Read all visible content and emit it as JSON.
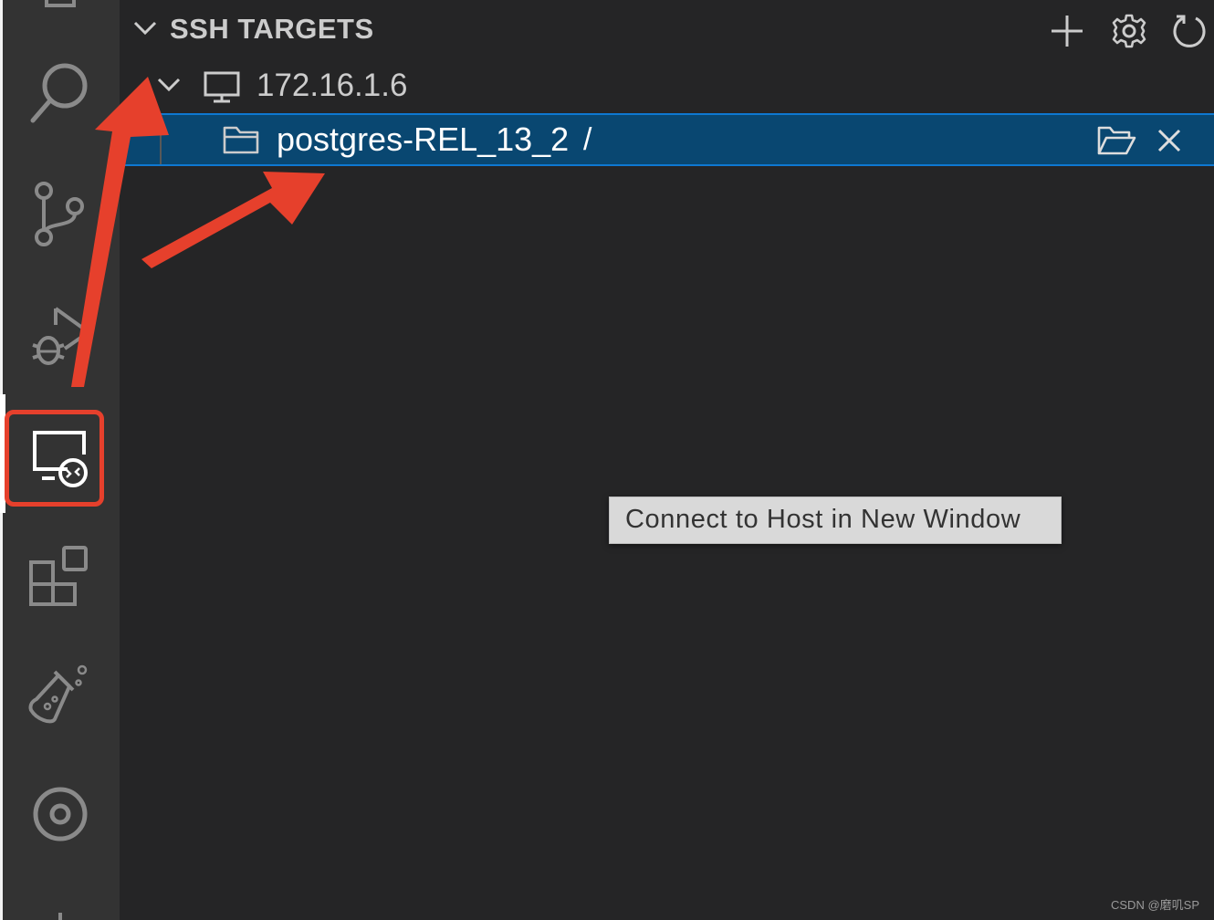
{
  "activity_bar": {
    "items": [
      {
        "name": "Search",
        "icon": "search-icon"
      },
      {
        "name": "Source Control",
        "icon": "source-control-icon"
      },
      {
        "name": "Run and Debug",
        "icon": "run-debug-icon"
      },
      {
        "name": "Remote Explorer",
        "icon": "remote-explorer-icon",
        "active": true
      },
      {
        "name": "Extensions",
        "icon": "extensions-icon"
      },
      {
        "name": "Testing",
        "icon": "testing-flask-icon"
      },
      {
        "name": "Timeline",
        "icon": "target-icon"
      }
    ]
  },
  "ssh_targets": {
    "title": "SSH TARGETS",
    "actions": [
      "add-icon",
      "gear-icon",
      "refresh-icon"
    ],
    "host": {
      "label": "172.16.1.6",
      "icon": "monitor-icon",
      "expanded": true
    },
    "folder": {
      "label": "postgres-REL_13_2",
      "path": "/",
      "icon": "folder-icon",
      "actions": [
        "open-folder-icon",
        "close-icon"
      ]
    }
  },
  "tooltip": {
    "text": "Connect to Host in New Window"
  },
  "watermark": {
    "text": "CSDN @磨叽SP"
  },
  "colors": {
    "activity_bar_bg": "#333333",
    "panel_bg": "#252526",
    "selection_bg": "#094771",
    "selection_border": "#0e78d1",
    "annotation_red": "#e6402c"
  }
}
